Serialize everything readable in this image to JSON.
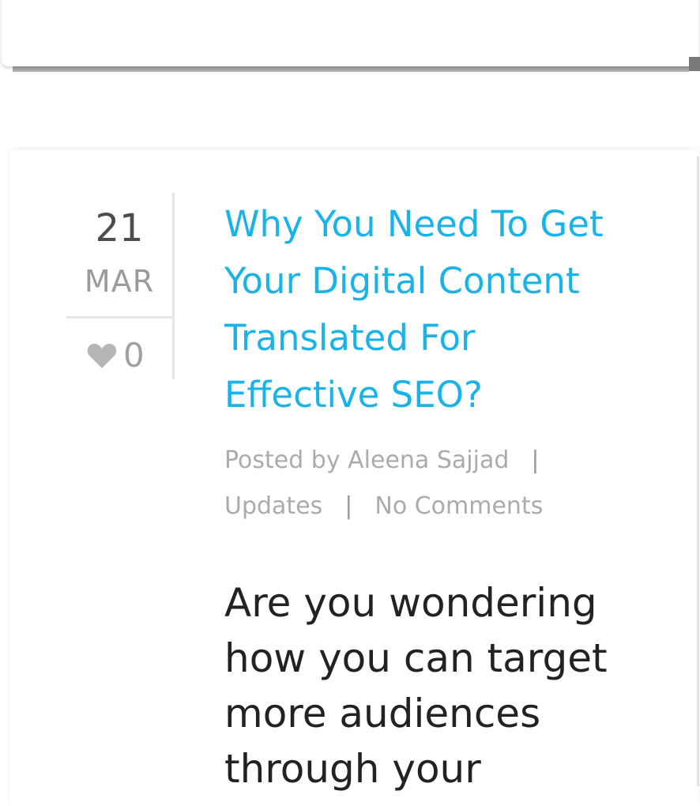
{
  "post": {
    "day": "21",
    "month": "MAR",
    "likes": "0",
    "title": "Why You Need To Get Your Digital Content Translated For Effective SEO?",
    "meta": {
      "posted_by": "Posted by Aleena Sajjad",
      "separator": "|",
      "category": "Updates",
      "comments": "No Comments"
    },
    "excerpt": "Are you wondering how you can target more audiences through your"
  },
  "icons": {
    "like": "heart-icon"
  },
  "colors": {
    "title": "#1ab3e8",
    "meta": "#ababab",
    "day": "#4d4d4d",
    "excerpt": "#222222"
  }
}
